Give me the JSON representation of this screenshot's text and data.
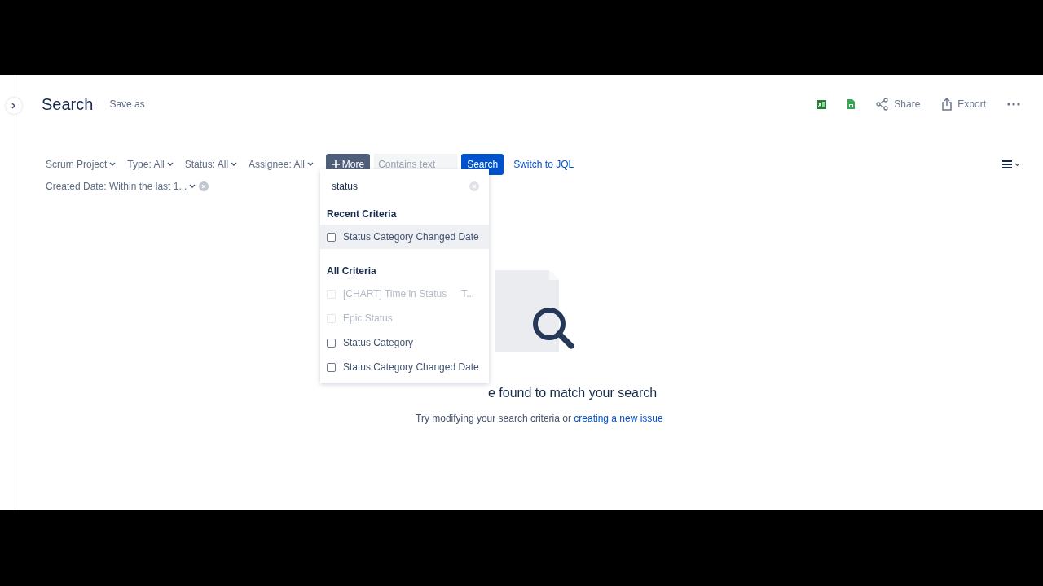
{
  "header": {
    "title": "Search",
    "save_as": "Save as",
    "actions": [
      {
        "kind": "excel"
      },
      {
        "kind": "sheets"
      },
      {
        "kind": "share",
        "label": "Share"
      },
      {
        "kind": "export",
        "label": "Export"
      },
      {
        "kind": "more"
      }
    ]
  },
  "filters": [
    {
      "label": "Scrum Project"
    },
    {
      "label": "Type: All"
    },
    {
      "label": "Status: All"
    },
    {
      "label": "Assignee: All"
    }
  ],
  "more_button": {
    "label": "More"
  },
  "text_search": {
    "placeholder": "Contains text"
  },
  "search_button": "Search",
  "switch_link": "Switch to JQL",
  "active_filter": {
    "label": "Created Date: Within the last 1..."
  },
  "dropdown": {
    "search": {
      "value": "status"
    },
    "sections": [
      {
        "title": "Recent Criteria",
        "items": [
          {
            "label": "Status Category Changed Date",
            "checked": false,
            "disabled": false,
            "selected": true
          }
        ]
      },
      {
        "title": "All Criteria",
        "items": [
          {
            "label": "[CHART] Time in Status",
            "note": "T...",
            "checked": false,
            "disabled": true,
            "selected": false
          },
          {
            "label": "Epic Status",
            "checked": false,
            "disabled": true,
            "selected": false
          },
          {
            "label": "Status Category",
            "checked": false,
            "disabled": false,
            "selected": false
          },
          {
            "label": "Status Category Changed Date",
            "checked": false,
            "disabled": false,
            "selected": false
          }
        ]
      }
    ]
  },
  "empty_state": {
    "heading": "e found to match your search",
    "text": "Try modifying your search criteria or",
    "link": "creating a new issue"
  }
}
